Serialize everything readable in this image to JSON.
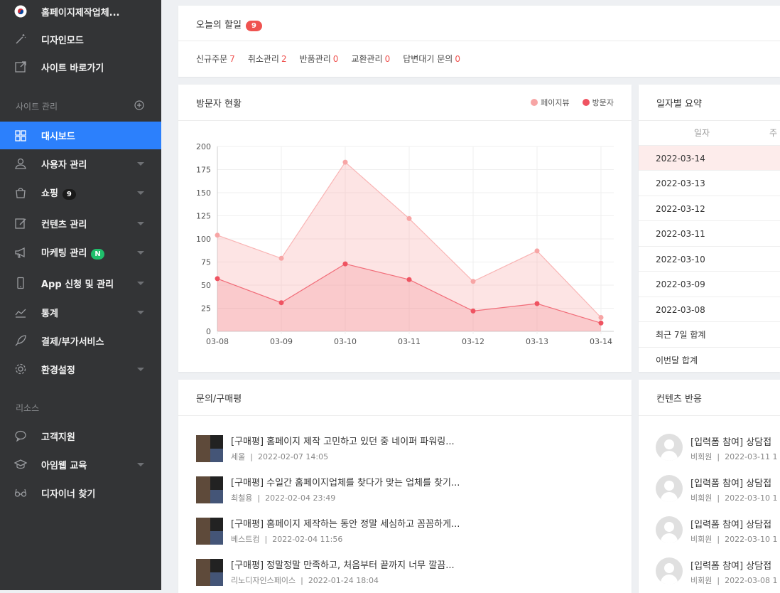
{
  "sidebar": {
    "site_name": "홈페이지제작업체...",
    "design_mode": "디자인모드",
    "goto_site": "사이트 바로가기",
    "section_site": "사이트 관리",
    "section_resource": "리소스",
    "items": [
      {
        "label": "대시보드",
        "icon": "dashboard-grid-icon"
      },
      {
        "label": "사용자 관리",
        "icon": "user-icon"
      },
      {
        "label": "쇼핑",
        "icon": "shopping-bag-icon",
        "badge": "9"
      },
      {
        "label": "컨텐츠 관리",
        "icon": "edit-icon"
      },
      {
        "label": "마케팅 관리",
        "icon": "megaphone-icon",
        "badge": "N"
      },
      {
        "label": "App 신청 및 관리",
        "icon": "mobile-icon"
      },
      {
        "label": "통계",
        "icon": "chart-icon"
      },
      {
        "label": "결제/부가서비스",
        "icon": "rocket-icon"
      },
      {
        "label": "환경설정",
        "icon": "gear-icon"
      }
    ],
    "resources": [
      {
        "label": "고객지원",
        "icon": "chat-icon"
      },
      {
        "label": "아임웹 교육",
        "icon": "graduation-icon"
      },
      {
        "label": "디자이너 찾기",
        "icon": "glasses-icon"
      }
    ]
  },
  "today": {
    "title": "오늘의 할일",
    "badge": "9",
    "stats": [
      {
        "label": "신규주문",
        "value": "7"
      },
      {
        "label": "취소관리",
        "value": "2"
      },
      {
        "label": "반품관리",
        "value": "0"
      },
      {
        "label": "교환관리",
        "value": "0"
      },
      {
        "label": "답변대기 문의",
        "value": "0"
      }
    ]
  },
  "visitors": {
    "title": "방문자 현황",
    "legend": [
      "페이지뷰",
      "방문자"
    ]
  },
  "chart_data": {
    "type": "area",
    "x": [
      "03-08",
      "03-09",
      "03-10",
      "03-11",
      "03-12",
      "03-13",
      "03-14"
    ],
    "series": [
      {
        "name": "페이지뷰",
        "values": [
          104,
          79,
          183,
          122,
          54,
          87,
          15
        ],
        "color": "#f7a5a5"
      },
      {
        "name": "방문자",
        "values": [
          57,
          31,
          73,
          56,
          22,
          30,
          9
        ],
        "color": "#ef5361"
      }
    ],
    "ylim": [
      0,
      200
    ],
    "yticks": [
      0,
      25,
      50,
      75,
      100,
      125,
      150,
      175,
      200
    ],
    "grid": true,
    "legend_position": "top-right"
  },
  "daily": {
    "title": "일자별 요약",
    "header": [
      "일자",
      "주"
    ],
    "rows": [
      "2022-03-14",
      "2022-03-13",
      "2022-03-12",
      "2022-03-11",
      "2022-03-10",
      "2022-03-09",
      "2022-03-08",
      "최근 7일 합계",
      "이번달 합계"
    ]
  },
  "reviews": {
    "title": "문의/구매평",
    "items": [
      {
        "title": "[구매평] 홈페이지 제작 고민하고 있던 중 네이퍼 파워링...",
        "author": "세울",
        "date": "2022-02-07 14:05"
      },
      {
        "title": "[구매평] 수일간 홈페이지업체를 찾다가 맞는 업체를 찾기...",
        "author": "최철용",
        "date": "2022-02-04 23:49"
      },
      {
        "title": "[구매평] 홈페이지 제작하는 동안 정말 세심하고 꼼꼼하게...",
        "author": "베스트컴",
        "date": "2022-02-04 11:56"
      },
      {
        "title": "[구매평] 정말정말 만족하고, 처음부터 끝까지 너무 깔끔...",
        "author": "리노디자인스페이스",
        "date": "2022-01-24 18:04"
      }
    ]
  },
  "content_reactions": {
    "title": "컨텐츠 반응",
    "items": [
      {
        "title": "[입력폼 참여] 상담접",
        "author": "비회원",
        "date": "2022-03-11 1"
      },
      {
        "title": "[입력폼 참여] 상담접",
        "author": "비회원",
        "date": "2022-03-10 1"
      },
      {
        "title": "[입력폼 참여] 상담접",
        "author": "비회원",
        "date": "2022-03-10 1"
      },
      {
        "title": "[입력폼 참여] 상담접",
        "author": "비회원",
        "date": "2022-03-08 1"
      }
    ]
  },
  "separator": "|"
}
